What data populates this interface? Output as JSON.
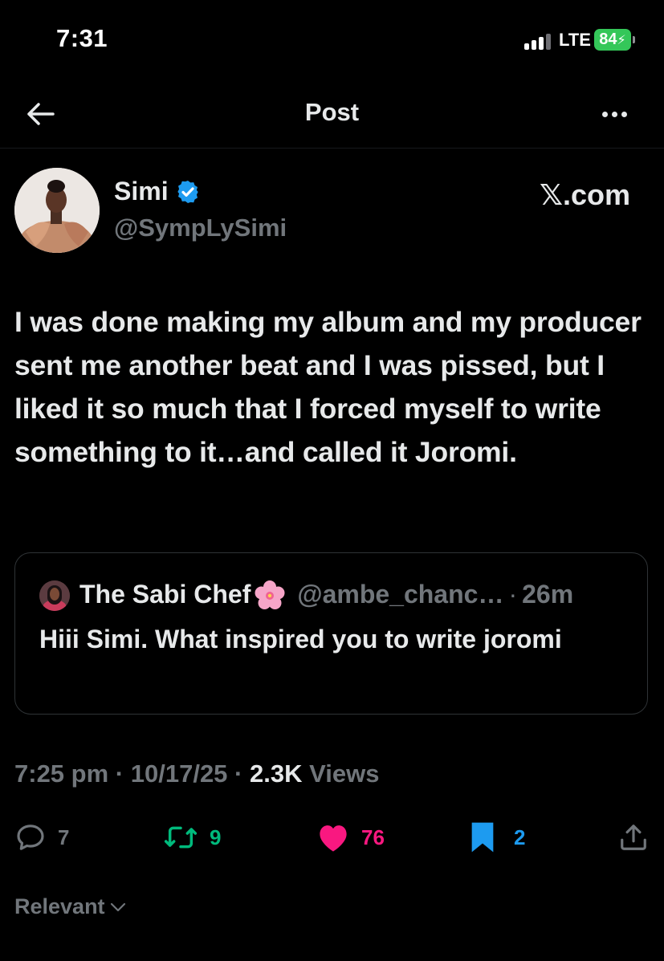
{
  "status_bar": {
    "time": "7:31",
    "network": "LTE",
    "battery": "84"
  },
  "header": {
    "title": "Post"
  },
  "post": {
    "author": {
      "display_name": "Simi",
      "handle": "@SympLySimi",
      "verified": true
    },
    "source_label": "𝕏.com",
    "text": "I was done making my album and my producer sent me another beat and I was pissed, but I liked it so much that I forced myself to write something to it…and called it Joromi.",
    "quote": {
      "display_name": "The Sabi Chef",
      "handle": "@ambe_chanc…",
      "separator": "·",
      "time_ago": "26m",
      "text": "Hiii Simi. What inspired you to write joromi"
    },
    "meta": {
      "time": "7:25 pm",
      "separator": "·",
      "date": "10/17/25",
      "views_count": "2.3K",
      "views_label": "Views"
    },
    "actions": {
      "replies": "7",
      "reposts": "9",
      "likes": "76",
      "bookmarks": "2"
    }
  },
  "sort": {
    "label": "Relevant"
  },
  "colors": {
    "background": "#000000",
    "text_primary": "#e7e9ea",
    "text_secondary": "#71767b",
    "verified_blue": "#1d9bf0",
    "repost_green": "#00ba7c",
    "like_pink": "#f91880",
    "bookmark_blue": "#1d9bf0",
    "battery_green": "#34c759"
  }
}
